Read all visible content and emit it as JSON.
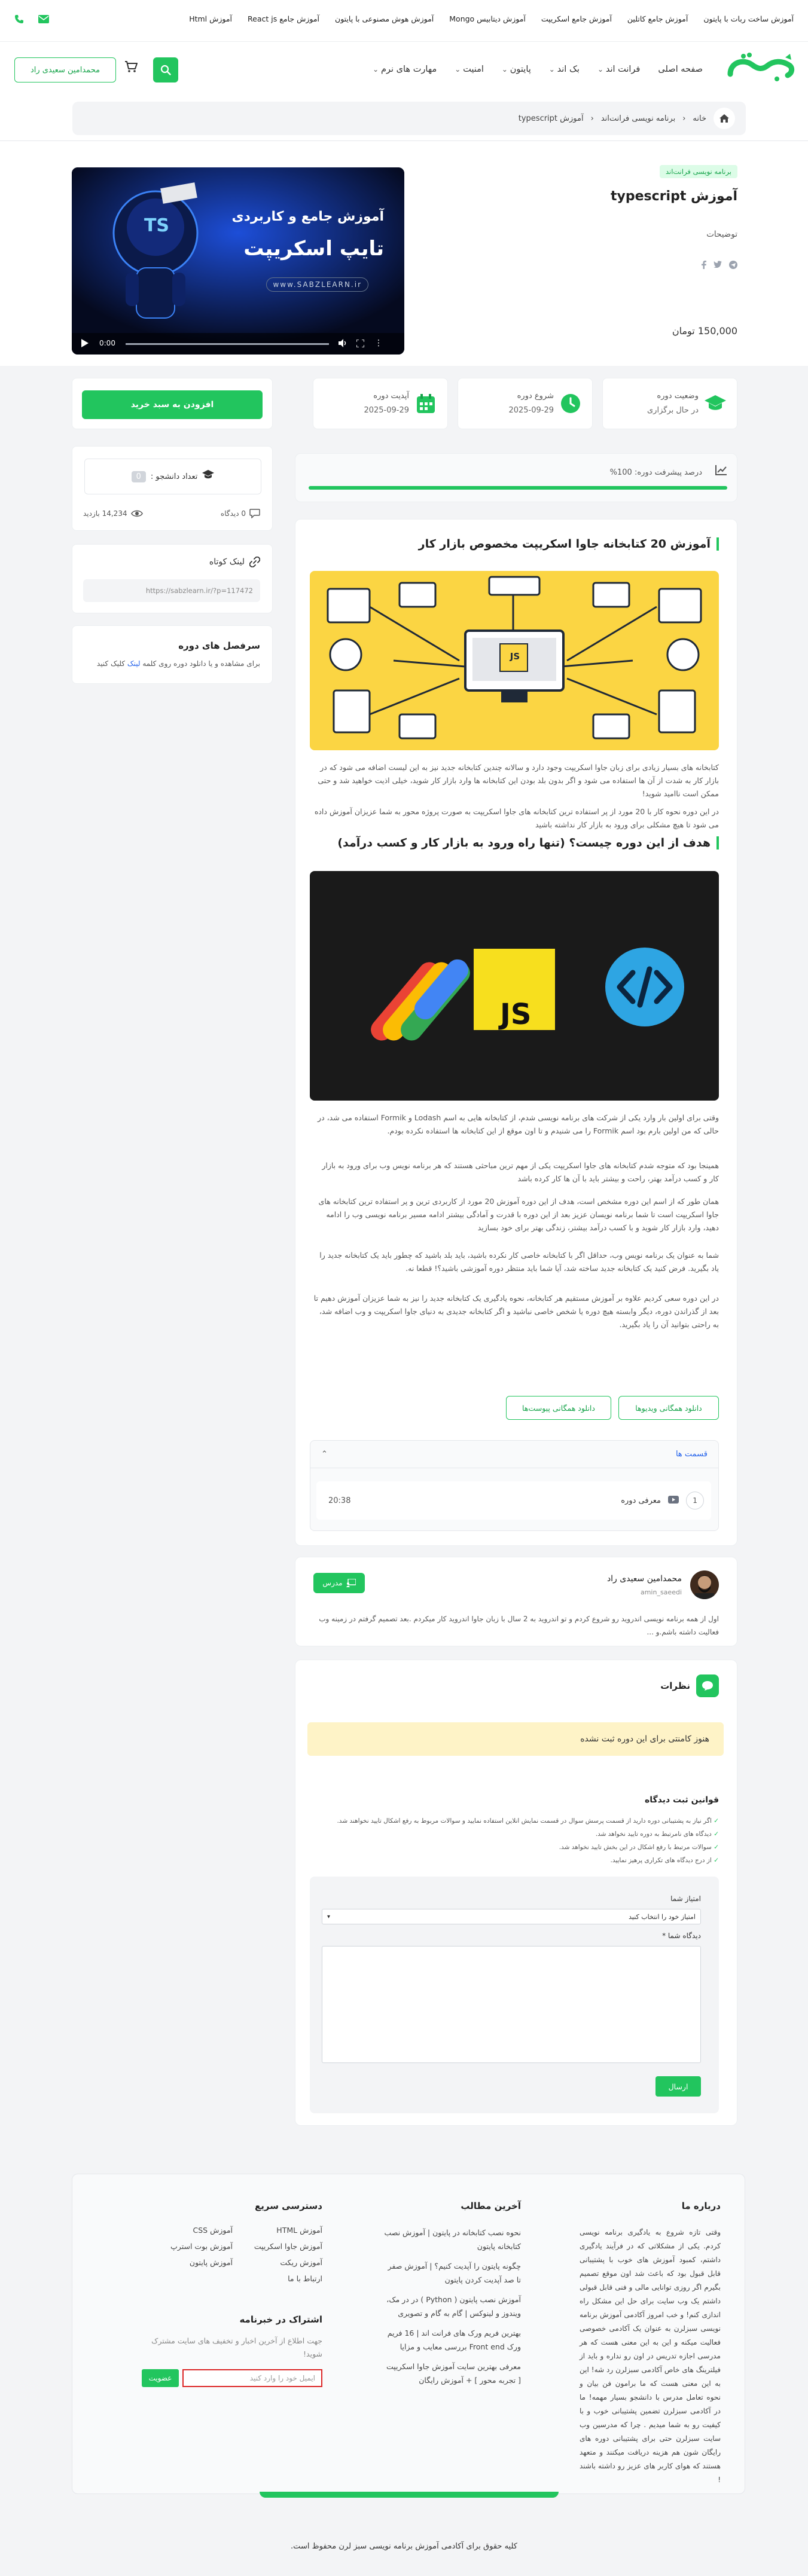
{
  "topbar": {
    "links": [
      "آموزش ساخت ربات با پایتون",
      "آموزش جامع کاتلین",
      "آموزش جامع اسکریپت",
      "آموزش دیتابیس Mongo",
      "آموزش هوش مصنوعی با پایتون",
      "آموزش جامع React js",
      "آموزش Html"
    ]
  },
  "header": {
    "logo_text": "سبزلرن",
    "nav": [
      "صفحه اصلی",
      "فرانت اند",
      "بک اند",
      "پایتون",
      "امنیت",
      "مهارت های نرم"
    ],
    "user_button": "محمدامین سعیدی راد"
  },
  "breadcrumb": [
    "خانه",
    "برنامه نویسی فرانت‌اند",
    "آموزش typescript"
  ],
  "course": {
    "category": "برنامه نویسی فرانت‌اند",
    "title": "آموزش typescript",
    "description_label": "توضیحات",
    "price": "150,000 تومان",
    "video_time": "0:00",
    "poster_title_1": "آموزش جامع و کاربردی",
    "poster_title_2": "تایپ اسکریپت",
    "poster_url": "www.SABZLEARN.ir",
    "poster_badge": "TS"
  },
  "info_cards": [
    {
      "title": "وضعیت دوره",
      "value": "در حال برگزاری"
    },
    {
      "title": "شروع دوره",
      "value": "2025-09-29"
    },
    {
      "title": "آپدیت دوره",
      "value": "2025-09-29"
    }
  ],
  "add_to_cart": "افزودن به سبد خرید",
  "progress": {
    "label": "درصد پیشرفت دوره: 100%",
    "percent": 100
  },
  "students": {
    "label": "تعداد دانشجو :",
    "count": "0"
  },
  "stats": {
    "comments": "0 دیدگاه",
    "views": "14,234 بازدید"
  },
  "short_link": {
    "title": "لینک کوتاه",
    "url": "https://sabzlearn.ir/?p=117472"
  },
  "syllabus_box": {
    "title": "سرفصل های دوره",
    "text": "برای مشاهده و یا دانلود دوره روی کلمه",
    "link": "لینک",
    "text2": "کلیک کنید"
  },
  "content": {
    "h1": "آموزش 20 کتابخانه جاوا اسکریپت مخصوص بازار کار",
    "p1": "کتابخانه های بسیار زیادی برای زبان جاوا اسکریپت وجود دارد و سالانه چندین کتابخانه جدید نیز به این لیست اضافه می شود که در بازار کار به شدت از آن ها استفاده می شود و اگر بدون بلد بودن این کتابخانه ها وارد بازار کار شوید، خیلی اذیت خواهید شد و حتی ممکن است ناامید شوید!",
    "p2": "در این دوره نحوه کار با 20 مورد از پر استفاده ترین کتابخانه های جاوا اسکریپت به صورت پروژه محور به شما عزیزان آموزش داده می شود تا هیچ مشکلی برای ورود به بازار کار نداشته باشید",
    "h2": "هدف از این دوره چیست؟ (تنها راه ورود به بازار کار و کسب درآمد)",
    "p3": "وقتی برای اولین بار وارد یکی از شرکت های برنامه نویسی شدم، از کتابخانه هایی به اسم Lodash و Formik استفاده می شد، در حالی که من اولین بارم بود اسم Formik را می شنیدم و تا اون موقع از این کتابخانه ها استفاده نکرده بودم.",
    "p4": "همینجا بود که متوجه شدم کتابخانه های جاوا اسکریپت یکی از مهم ترین مباحثی هستند که هر برنامه نویس وب برای ورود به بازار کار و کسب درآمد بهتر، راحت و بیشتر باید با آن ها کار کرده باشد",
    "p5": "همان طور که از اسم این دوره مشخص است، هدف از این دوره آموزش 20 مورد از کاربردی ترین و پر استفاده ترین کتابخانه های جاوا اسکریپت است تا شما برنامه نویسان عزیز بعد از این دوره با قدرت و آمادگی بیشتر ادامه مسیر برنامه نویسی وب را ادامه دهید، وارد بازار کار شوید و با کسب درآمد بیشتر، زندگی بهتر برای خود بسازید",
    "p6": "شما به عنوان یک برنامه نویس وب، حداقل اگر با کتابخانه خاصی کار نکرده باشید، باید بلد باشید که چطور باید یک کتابخانه جدید را یاد بگیرید. فرض کنید یک کتابخانه جدید ساخته شد، آیا شما باید منتظر دوره آموزشی باشید؟! قطعا نه.",
    "p7": "در این دوره سعی کردیم علاوه بر آموزش مستقیم هر کتابخانه، نحوه یادگیری یک کتابخانه جدید را نیز به شما عزیزان آموزش دهیم تا بعد از گذراندن دوره، دیگر وابسته هیچ دوره یا شخص خاصی نباشید و اگر کتابخانه جدیدی به دنیای جاوا اسکریپت و وب اضافه شد، به راحتی بتوانید آن را یاد بگیرید.",
    "dl_videos": "دانلود همگانی ویدیوها",
    "dl_attachments": "دانلود همگانی پیوست‌ها",
    "section_title": "قسمت ها",
    "lesson_num": "1",
    "lesson_title": "معرفی دوره",
    "lesson_time": "20:38",
    "js_label": "JS"
  },
  "teacher": {
    "name": "محمدامین سعیدی راد",
    "handle": "amin_saeedi",
    "badge": "مدرس",
    "bio": "اول از همه برنامه نویسی اندروید رو شروع کردم و تو اندروید به 2 سال با زبان جاوا اندروید کار میکردم .بعد تصمیم گرفتم در زمینه وب فعالیت داشته باشم.و ..."
  },
  "comments": {
    "title": "نظرات",
    "empty": "هنوز کامنتی برای این دوره ثبت نشده",
    "rules_title": "قوانین ثبت دیدگاه",
    "rules": [
      "اگر نیاز به پشتیبانی دوره دارید از قسمت پرسش سوال در قسمت نمایش انلاین استفاده نمایید و سوالات مربوط به رفع اشکال تایید نخواهند شد.",
      "دیدگاه های نامرتبط به دوره تایید نخواهد شد.",
      "سوالات مرتبط با رفع اشکال در این بخش تایید نخواهد شد.",
      "از درج دیدگاه های تکراری پرهیز نمایید."
    ],
    "score_label": "امتیاز شما",
    "score_placeholder": "امتیاز خود را انتخاب کنید",
    "comment_label": "دیدگاه شما *",
    "submit": "ارسال"
  },
  "footer": {
    "about_title": "درباره ما",
    "about_text": "وقتی تازه شروع به یادگیری برنامه نویسی کردم. یکی از مشکلاتی که در فرآیند یادگیری داشتم، کمبود آموزش های خوب با پشتیبانی قابل قبول بود که باعث شد اون موقع تصمیم بگیرم اگر روزی توانایی مالی و فنی قابل قبولی داشتم یک وب سایت برای حل این مشکل راه اندازی کنم! و خب امروز آکادمی آموزش برنامه نویسی سبزلرن به عنوان یک آکادمی خصوصی فعالیت میکنه و این به این معنی هست که هر مدرسی اجازه تدریس در اون رو نداره و باید از فیلترینگ های خاص آکادمی سبزلرن رد شه! این به این معنی هست که ما برامون فن بیان و نحوه تعامل مدرس با دانشجو بسیار مهمه! ما در آکادمی سبزلرن تضمین پشتیبانی خوب و با کیفیت رو به شما میدیم . چرا که مدرسین وب سایت سبزلرن حتی برای پشتیبانی دوره های رایگان شون هم هزینه دریافت میکنند و متعهد هستند که هوای کاربر های عزیز رو داشته باشند !",
    "latest_title": "آخرین مطالب",
    "latest": [
      "نحوه نصب کتابخانه در پایتون | آموزش نصب کتابخانه پایتون",
      "چگونه پایتون را آپدیت کنیم؟ | آموزش صفر تا صد آپدیت کردن پایتون",
      "آموزش نصب پایتون ( Python ) در در مک، ویندوز و لینوکس | گام به گام و تصویری",
      "بهترین فریم ورک های فرانت اند | 16 فریم ورک Front end بررسی معایب و مزایا",
      "معرفی بهترین سایت آموزش جاوا اسکریپت [ تجربه محور ] + آموزش رایگان"
    ],
    "quick_title": "دسترسی سریع",
    "quick": [
      "آموزش HTML",
      "آموزش CSS",
      "آموزش جاوا اسکریپت",
      "آموزش بوت استرپ",
      "آموزش ریکت",
      "آموزش پایتون",
      "ارتباط با ما"
    ],
    "newsletter_title": "اشتراک در خبرنامه",
    "newsletter_text": "جهت اطلاع از آخرین اخبار و تخفیف های سایت مشترک شوید!",
    "newsletter_placeholder": "ایمیل خود را وارد کنید",
    "newsletter_button": "عضویت",
    "copyright": "کلیه حقوق برای آکادمی آموزش برنامه نویسی سبز لرن محفوظ است."
  }
}
